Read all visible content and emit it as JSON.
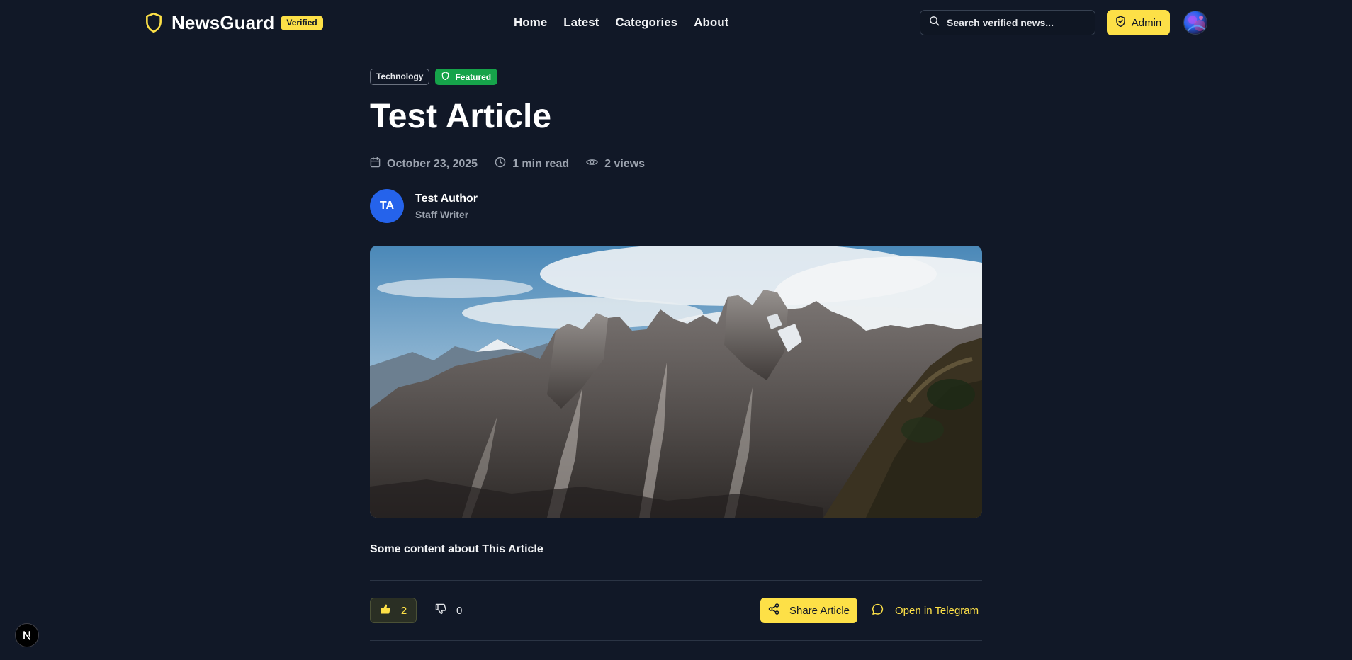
{
  "header": {
    "brand_name": "NewsGuard",
    "verified_label": "Verified",
    "nav": [
      "Home",
      "Latest",
      "Categories",
      "About"
    ],
    "search_placeholder": "Search verified news...",
    "admin_label": "Admin"
  },
  "article": {
    "category": "Technology",
    "featured_label": "Featured",
    "title": "Test Article",
    "date": "October 23, 2025",
    "read_time": "1 min read",
    "views": "2 views",
    "author": {
      "initials": "TA",
      "name": "Test Author",
      "role": "Staff Writer"
    },
    "content": "Some content about This Article"
  },
  "actions": {
    "likes": "2",
    "dislikes": "0",
    "share_label": "Share Article",
    "telegram_label": "Open in Telegram"
  },
  "colors": {
    "background": "#111827",
    "accent": "#fde047",
    "featured": "#16a34a",
    "author_avatar": "#2563eb"
  }
}
